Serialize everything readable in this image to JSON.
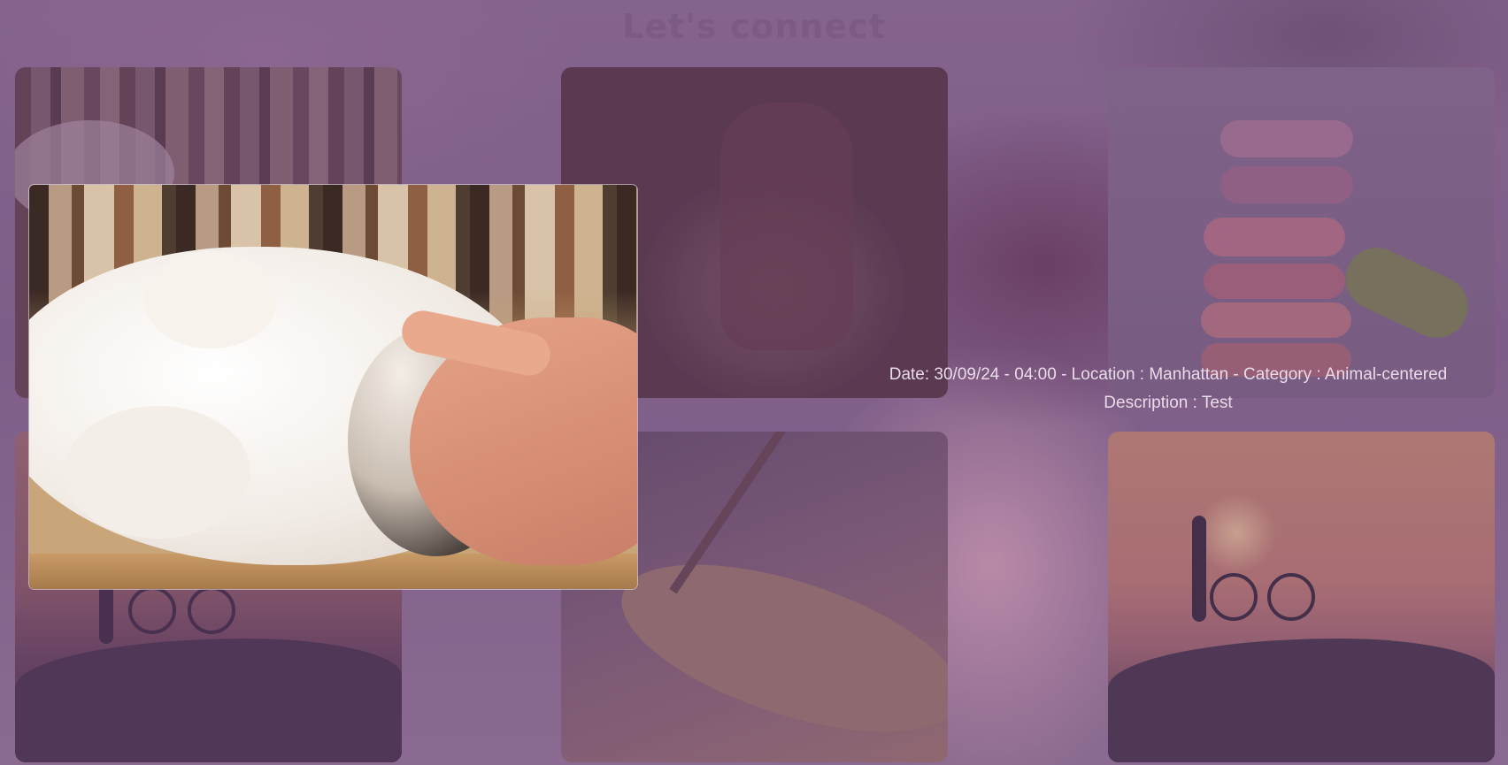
{
  "page": {
    "title": "Let's connect"
  },
  "gallery": {
    "tiles": [
      {
        "icon": "kitten-books-photo"
      },
      {
        "icon": "pottery-wheel-photo"
      },
      {
        "icon": "macarons-photo"
      },
      {
        "icon": "cyclist-sunset-photo"
      },
      {
        "icon": "paint-palette-photo"
      },
      {
        "icon": "cyclist-sunset-photo"
      }
    ]
  },
  "modal": {
    "image": "kitten-being-petted-photo",
    "meta_line": "Date: 30/09/24 - 04:00 - Location : Manhattan - Category : Animal-centered",
    "description_line": "Description : Test"
  }
}
